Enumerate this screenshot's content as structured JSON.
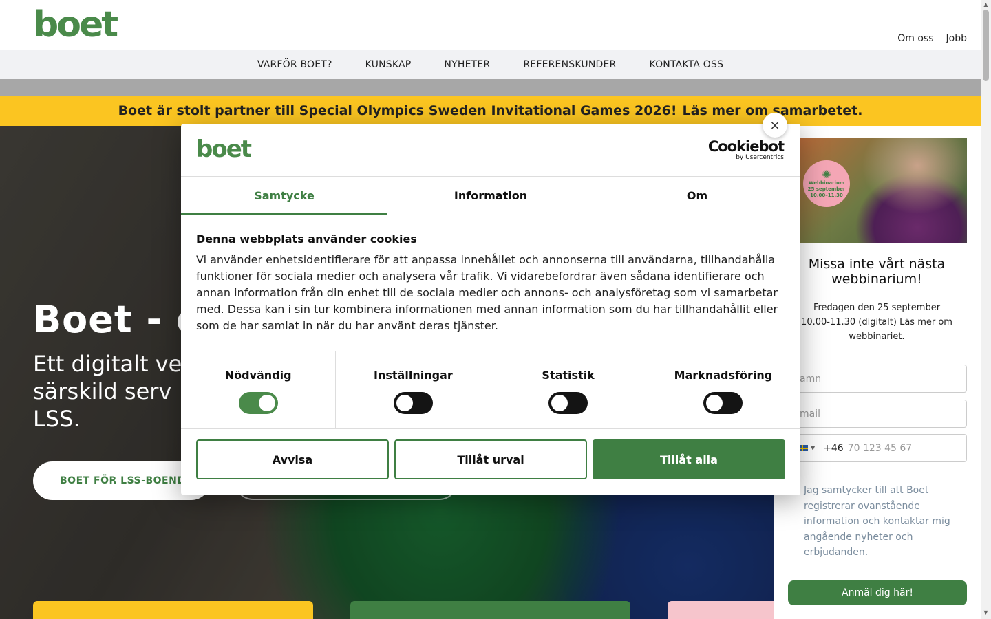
{
  "header": {
    "logo": "boet",
    "top_links": [
      "Om oss",
      "Jobb"
    ]
  },
  "nav": {
    "items": [
      "VARFÖR BOET?",
      "KUNSKAP",
      "NYHETER",
      "REFERENSKUNDER",
      "KONTAKTA OSS"
    ]
  },
  "banner": {
    "text": "Boet är stolt partner till Special Olympics Sweden Invitational Games 2026!",
    "link": "Läs mer om samarbetet."
  },
  "hero": {
    "title": "Boet - d",
    "subtitle_lines": [
      "Ett digitalt ve",
      "särskild serv",
      "LSS."
    ],
    "button": "BOET FÖR LSS-BOENDE"
  },
  "sidebar": {
    "badge": {
      "line1": "Webbinarium",
      "line2": "25 september",
      "line3": "10.00–11.30"
    },
    "title": "Missa inte vårt nästa webbinarium!",
    "text": "Fredagen den 25 september 10.00-11.30 (digitalt) Läs mer om webbinariet.",
    "name_placeholder": "amn",
    "email_placeholder": "mail",
    "phone_prefix": "+46",
    "phone_placeholder": "70 123 45 67",
    "consent": "Jag samtycker till att Boet registrerar ovanstående information och kontaktar mig angående nyheter och erbjudanden.",
    "signup": "Anmäl dig här!"
  },
  "dialog": {
    "logo": "boet",
    "provider_name": "Cookiebot",
    "provider_sub": "by Usercentrics",
    "close_symbol": "×",
    "tabs": [
      "Samtycke",
      "Information",
      "Om"
    ],
    "active_tab": "Samtycke",
    "heading": "Denna webbplats använder cookies",
    "body": "Vi använder enhetsidentifierare för att anpassa innehållet och annonserna till användarna, tillhandahålla funktioner för sociala medier och analysera vår trafik. Vi vidarebefordrar även sådana identifierare och annan information från din enhet till de sociala medier och annons- och analysföretag som vi samarbetar med. Dessa kan i sin tur kombinera informationen med annan information som du har tillhandahållit eller som de har samlat in när du har använt deras tjänster.",
    "toggles": [
      {
        "label": "Nödvändig",
        "on": true
      },
      {
        "label": "Inställningar",
        "on": false
      },
      {
        "label": "Statistik",
        "on": false
      },
      {
        "label": "Marknadsföring",
        "on": false
      }
    ],
    "buttons": {
      "reject": "Avvisa",
      "selection": "Tillåt urval",
      "allow_all": "Tillåt alla"
    }
  },
  "colors": {
    "brand_green": "#3f7f43",
    "banner_yellow": "#fbc521",
    "toggle_off": "#141414"
  }
}
